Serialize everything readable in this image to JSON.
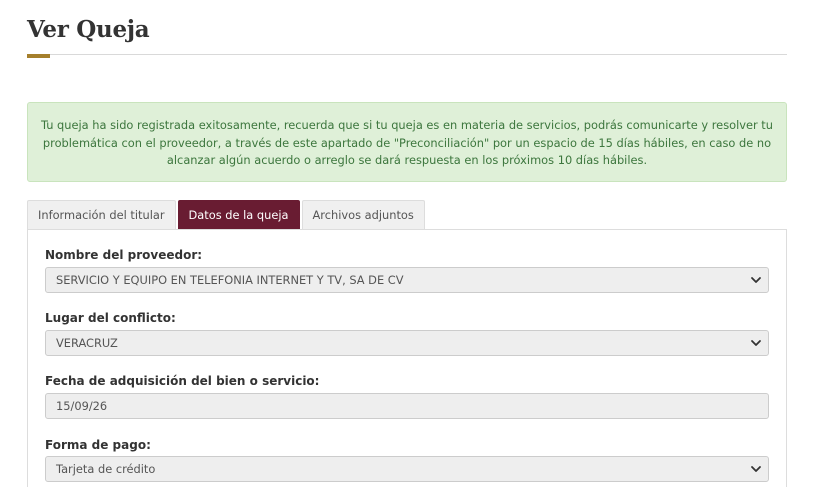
{
  "page": {
    "title": "Ver Queja"
  },
  "alert": {
    "message": "Tu queja ha sido registrada exitosamente, recuerda que si tu queja es en materia de servicios, podrás comunicarte y resolver tu problemática con el proveedor, a través de este apartado de \"Preconciliación\" por un espacio de 15 días hábiles, en caso de no alcanzar algún acuerdo o arreglo se dará respuesta en los próximos 10 días hábiles."
  },
  "tabs": [
    {
      "label": "Información del titular",
      "active": false
    },
    {
      "label": "Datos de la queja",
      "active": true
    },
    {
      "label": "Archivos adjuntos",
      "active": false
    }
  ],
  "form": {
    "proveedor": {
      "label": "Nombre del proveedor:",
      "value": "SERVICIO Y EQUIPO EN TELEFONIA INTERNET Y TV, SA DE CV",
      "icon": "chevron-down-icon"
    },
    "lugar": {
      "label": "Lugar del conflicto:",
      "value": "VERACRUZ",
      "icon": "chevron-down-icon"
    },
    "fecha": {
      "label": "Fecha de adquisición del bien o servicio:",
      "value": "15/09/26"
    },
    "pago": {
      "label": "Forma de pago:",
      "value": "Tarjeta de crédito",
      "icon": "chevron-down-icon"
    }
  },
  "colors": {
    "accent": "#691c32",
    "title_underline": "#a57f2c",
    "alert_bg": "#dff0d8",
    "alert_text": "#3c763d"
  }
}
